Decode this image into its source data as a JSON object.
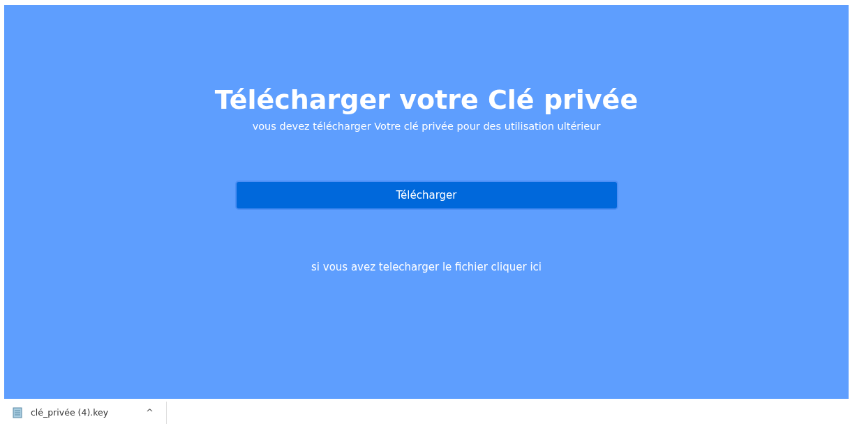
{
  "page": {
    "title": "Télécharger votre Clé privée",
    "subtitle": "vous devez télécharger Votre clé privée pour des utilisation ultérieur",
    "download_button": "Télécharger",
    "link": "si vous avez telecharger le fichier cliquer ici"
  },
  "download_bar": {
    "items": [
      {
        "filename": "clé_privée (4).key",
        "caret": "^"
      }
    ]
  }
}
